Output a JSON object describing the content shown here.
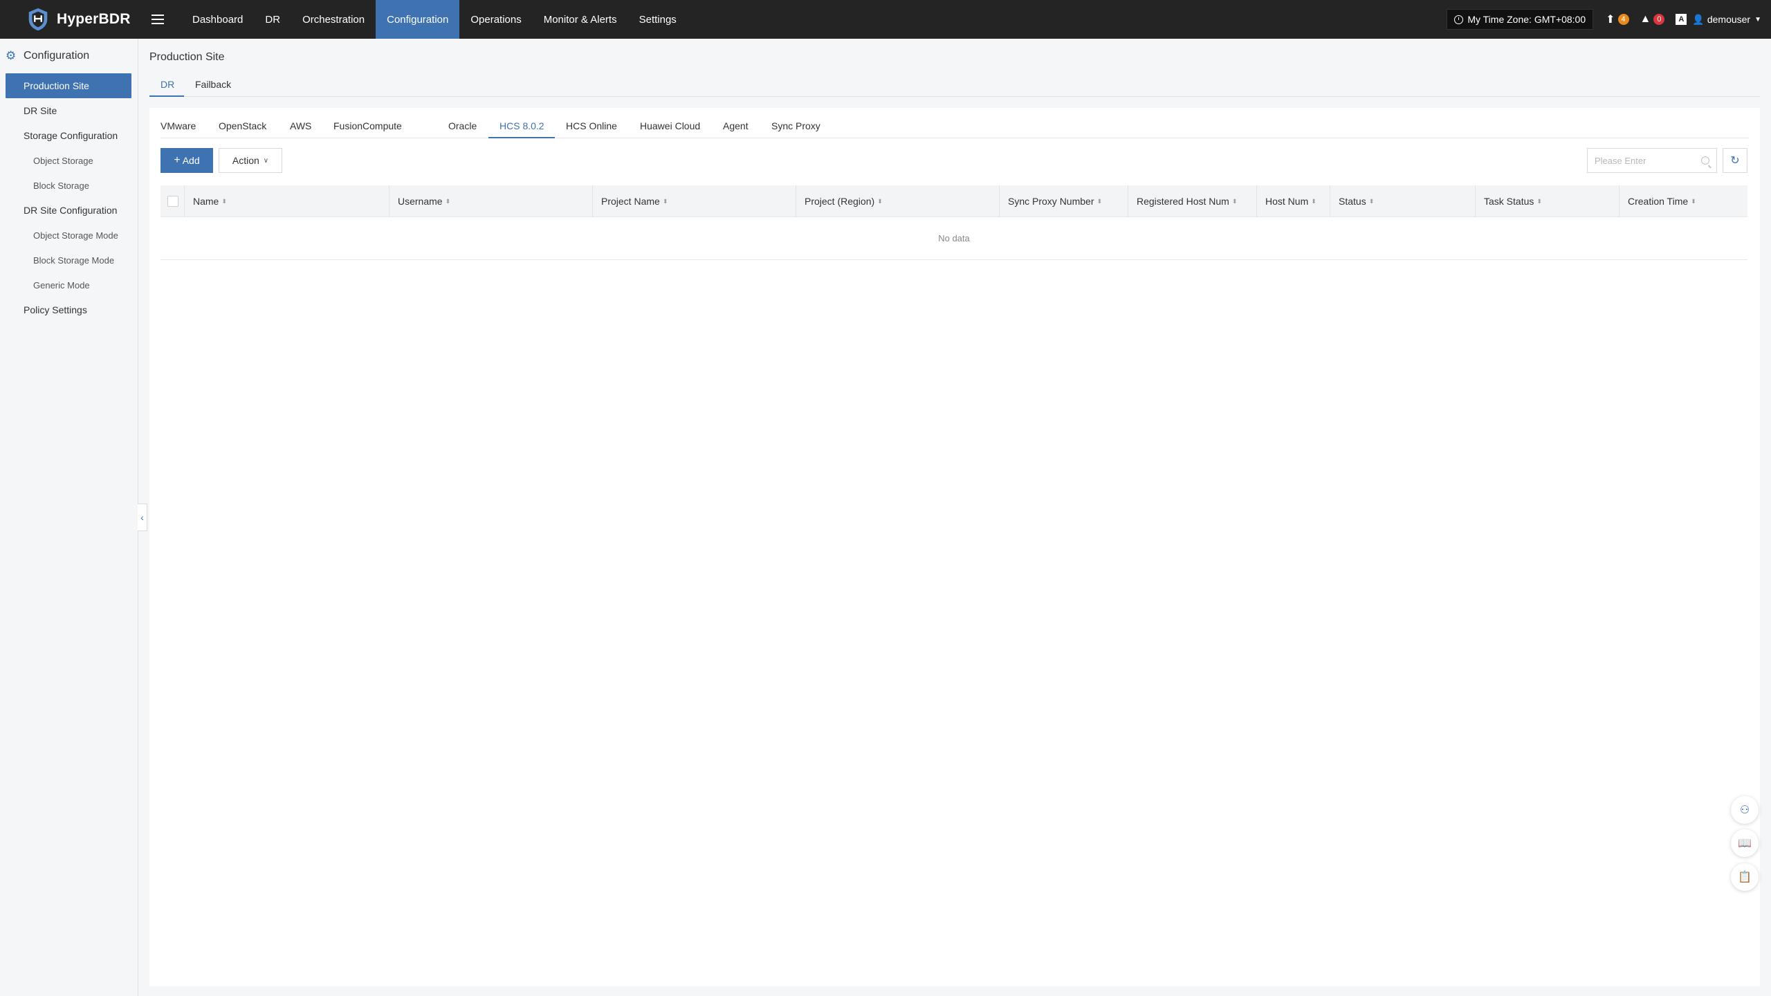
{
  "app": {
    "brand": "HyperBDR"
  },
  "nav": {
    "items": [
      {
        "label": "Dashboard"
      },
      {
        "label": "DR"
      },
      {
        "label": "Orchestration"
      },
      {
        "label": "Configuration"
      },
      {
        "label": "Operations"
      },
      {
        "label": "Monitor & Alerts"
      },
      {
        "label": "Settings"
      }
    ],
    "active": "Configuration"
  },
  "topright": {
    "timezone": "My Time Zone: GMT+08:00",
    "upgrade_count": "4",
    "alert_count": "0",
    "lang_icon": "A",
    "username": "demouser"
  },
  "sidebar": {
    "title": "Configuration",
    "items": [
      {
        "label": "Production Site",
        "level": 1,
        "active": true
      },
      {
        "label": "DR Site",
        "level": 1
      },
      {
        "label": "Storage Configuration",
        "level": 1
      },
      {
        "label": "Object Storage",
        "level": 2
      },
      {
        "label": "Block Storage",
        "level": 2
      },
      {
        "label": "DR Site Configuration",
        "level": 1
      },
      {
        "label": "Object Storage Mode",
        "level": 2
      },
      {
        "label": "Block Storage Mode",
        "level": 2
      },
      {
        "label": "Generic Mode",
        "level": 2
      },
      {
        "label": "Policy Settings",
        "level": 1
      }
    ]
  },
  "page": {
    "title": "Production Site",
    "subtabs": [
      {
        "label": "DR",
        "active": true
      },
      {
        "label": "Failback"
      }
    ],
    "platform_tabs": [
      {
        "label": "VMware"
      },
      {
        "label": "OpenStack"
      },
      {
        "label": "AWS"
      },
      {
        "label": "FusionCompute"
      },
      {
        "label": "Oracle"
      },
      {
        "label": "HCS 8.0.2",
        "active": true
      },
      {
        "label": "HCS Online"
      },
      {
        "label": "Huawei Cloud"
      },
      {
        "label": "Agent"
      },
      {
        "label": "Sync Proxy"
      }
    ],
    "toolbar": {
      "add_label": "Add",
      "action_label": "Action",
      "search_placeholder": "Please Enter"
    },
    "table": {
      "columns": [
        {
          "label": "Name"
        },
        {
          "label": "Username"
        },
        {
          "label": "Project Name"
        },
        {
          "label": "Project (Region)"
        },
        {
          "label": "Sync Proxy Number"
        },
        {
          "label": "Registered Host Num"
        },
        {
          "label": "Host Num"
        },
        {
          "label": "Status"
        },
        {
          "label": "Task Status"
        },
        {
          "label": "Creation Time"
        }
      ],
      "empty_text": "No data"
    }
  },
  "floating": [
    {
      "icon": "chat-robot-icon"
    },
    {
      "icon": "book-icon"
    },
    {
      "icon": "clipboard-icon"
    }
  ],
  "colors": {
    "accent": "#3e72b0",
    "topbar": "#242424",
    "badge_orange": "#e88a1d",
    "badge_red": "#d9363e"
  }
}
